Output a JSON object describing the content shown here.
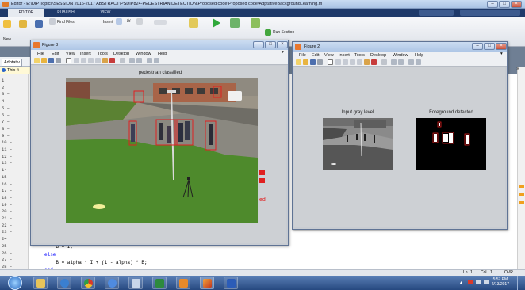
{
  "editor": {
    "title": "Editor - E:\\DIP Topics\\SESSION 2016-2017 ABSTRACT\\PSDIP824-PEDESTRIAN DETECTION\\Proposed code\\Proposed code\\AdptativeBackgroundLearning.m",
    "tabs": [
      "EDITOR",
      "PUBLISH",
      "VIEW"
    ],
    "ribbon": {
      "new": "New",
      "find_files": "Find Files",
      "insert": "Insert",
      "fx": "fx",
      "run_section": "Run Section"
    },
    "file_tab": "Adptativ",
    "info_text": "This fi",
    "line_numbers": [
      "1",
      "2",
      "3 –",
      "4 –",
      "5 –",
      "6 –",
      "7 –",
      "8 –",
      "9 –",
      "10 –",
      "11 –",
      "12 –",
      "13 –",
      "14 –",
      "15 –",
      "16 –",
      "17 –",
      "18 –",
      "19 –",
      "20 –",
      "21 –",
      "22 –",
      "23 –",
      "24",
      "25",
      "26 –",
      "27 –",
      "28 –"
    ],
    "code": {
      "line26": "    B = I;",
      "line27": "else",
      "line28": "    B = alpha * I + (1 - alpha) * B;",
      "line29": "end"
    },
    "status": {
      "ln_label": "Ln",
      "ln": "1",
      "col_label": "Col",
      "col": "1",
      "mode": "OVR"
    }
  },
  "figure3": {
    "title": "Figure 3",
    "menu": [
      "File",
      "Edit",
      "View",
      "Insert",
      "Tools",
      "Desktop",
      "Window",
      "Help"
    ],
    "axes_title": "pedestrian classified",
    "side_text": "ed"
  },
  "figure2": {
    "title": "Figure 2",
    "menu": [
      "File",
      "Edit",
      "View",
      "Insert",
      "Tools",
      "Desktop",
      "Window",
      "Help"
    ],
    "left_title": "Input gray level",
    "right_title": "Foreground detected"
  },
  "taskbar": {
    "apps": [
      "start-orb",
      "explorer",
      "media-player",
      "chrome",
      "app-swirl",
      "app-pen",
      "excel",
      "java-app",
      "matlab",
      "word"
    ],
    "time": "5:57 PM",
    "date": "2/13/2017"
  },
  "colors": {
    "title_bar": "#b5cbe8",
    "ribbon_tabs": "#1f3a6a",
    "figure_bg": "#cdd0d4",
    "detection_box": "#e02020",
    "taskbar": "#2c4f88"
  }
}
